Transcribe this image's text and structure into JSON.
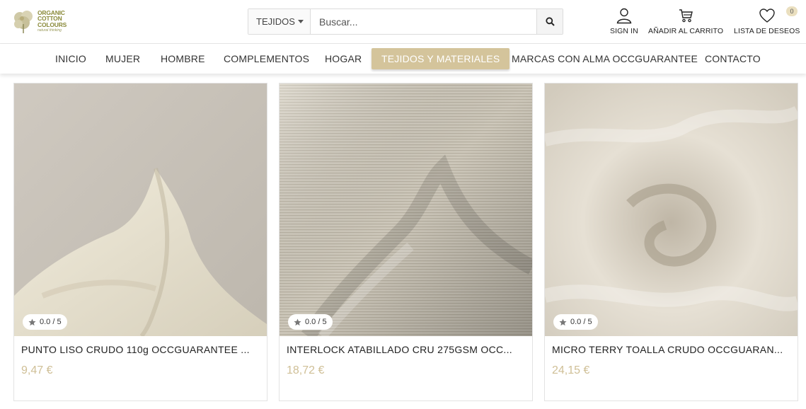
{
  "brand": {
    "line1": "ORGANIC",
    "line2": "COTTON",
    "line3": "COLOURS",
    "tagline": "natural thinking"
  },
  "search": {
    "category": "TEJIDOS",
    "placeholder": "Buscar..."
  },
  "header_actions": {
    "sign_in": "SIGN IN",
    "cart": "AÑADIR AL CARRITO",
    "wishlist": "LISTA DE DESEOS",
    "wishlist_count": "0"
  },
  "nav": {
    "items": [
      "INICIO",
      "MUJER",
      "HOMBRE",
      "COMPLEMENTOS",
      "HOGAR",
      "TEJIDOS Y MATERIALES",
      "MARCAS CON ALMA OCCGUARANTEE",
      "CONTACTO"
    ],
    "active": "TEJIDOS Y MATERIALES"
  },
  "products": [
    {
      "title": "PUNTO LISO CRUDO 110g OCCGUARANTEE ...",
      "price": "9,47 €",
      "rating": "0.0 / 5"
    },
    {
      "title": "INTERLOCK ATABILLADO CRU 275GSM OCC...",
      "price": "18,72 €",
      "rating": "0.0 / 5"
    },
    {
      "title": "MICRO TERRY TOALLA CRUDO OCCGUARAN...",
      "price": "24,15 €",
      "rating": "0.0 / 5"
    }
  ],
  "colors": {
    "accent": "#d4c49b",
    "price": "#cfbf96",
    "logo": "#8a8a3a"
  }
}
